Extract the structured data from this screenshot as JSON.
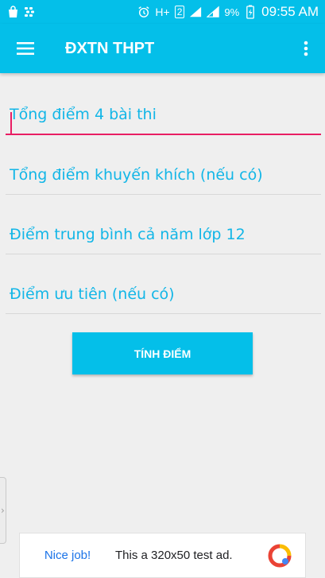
{
  "status_bar": {
    "battery_percent": "9%",
    "network_type": "H+",
    "sim_slot": "2",
    "time": "09:55 AM",
    "icons": [
      "shopping-bag-icon",
      "blackberry-icon",
      "alarm-icon",
      "wifi-icon",
      "signal-icon",
      "battery-charging-icon"
    ]
  },
  "app_bar": {
    "title": "ĐXTN THPT",
    "menu_icon": "hamburger-menu-icon",
    "overflow_icon": "more-vertical-icon"
  },
  "form": {
    "fields": [
      {
        "placeholder": "Tổng điểm 4 bài thi",
        "value": ""
      },
      {
        "placeholder": "Tổng điểm khuyến khích (nếu có)",
        "value": ""
      },
      {
        "placeholder": "Điểm trung bình cả năm lớp 12",
        "value": ""
      },
      {
        "placeholder": "Điểm ưu tiên (nếu có)",
        "value": ""
      }
    ],
    "submit_label": "TÍNH ĐIỂM"
  },
  "colors": {
    "primary": "#04bfe9",
    "accent": "#e91e63",
    "background": "#efefef",
    "hint": "#12b6e7"
  },
  "ad": {
    "badge_text": "Nice job!",
    "message": "This a 320x50 test ad.",
    "logo_icon": "google-ads-icon"
  }
}
